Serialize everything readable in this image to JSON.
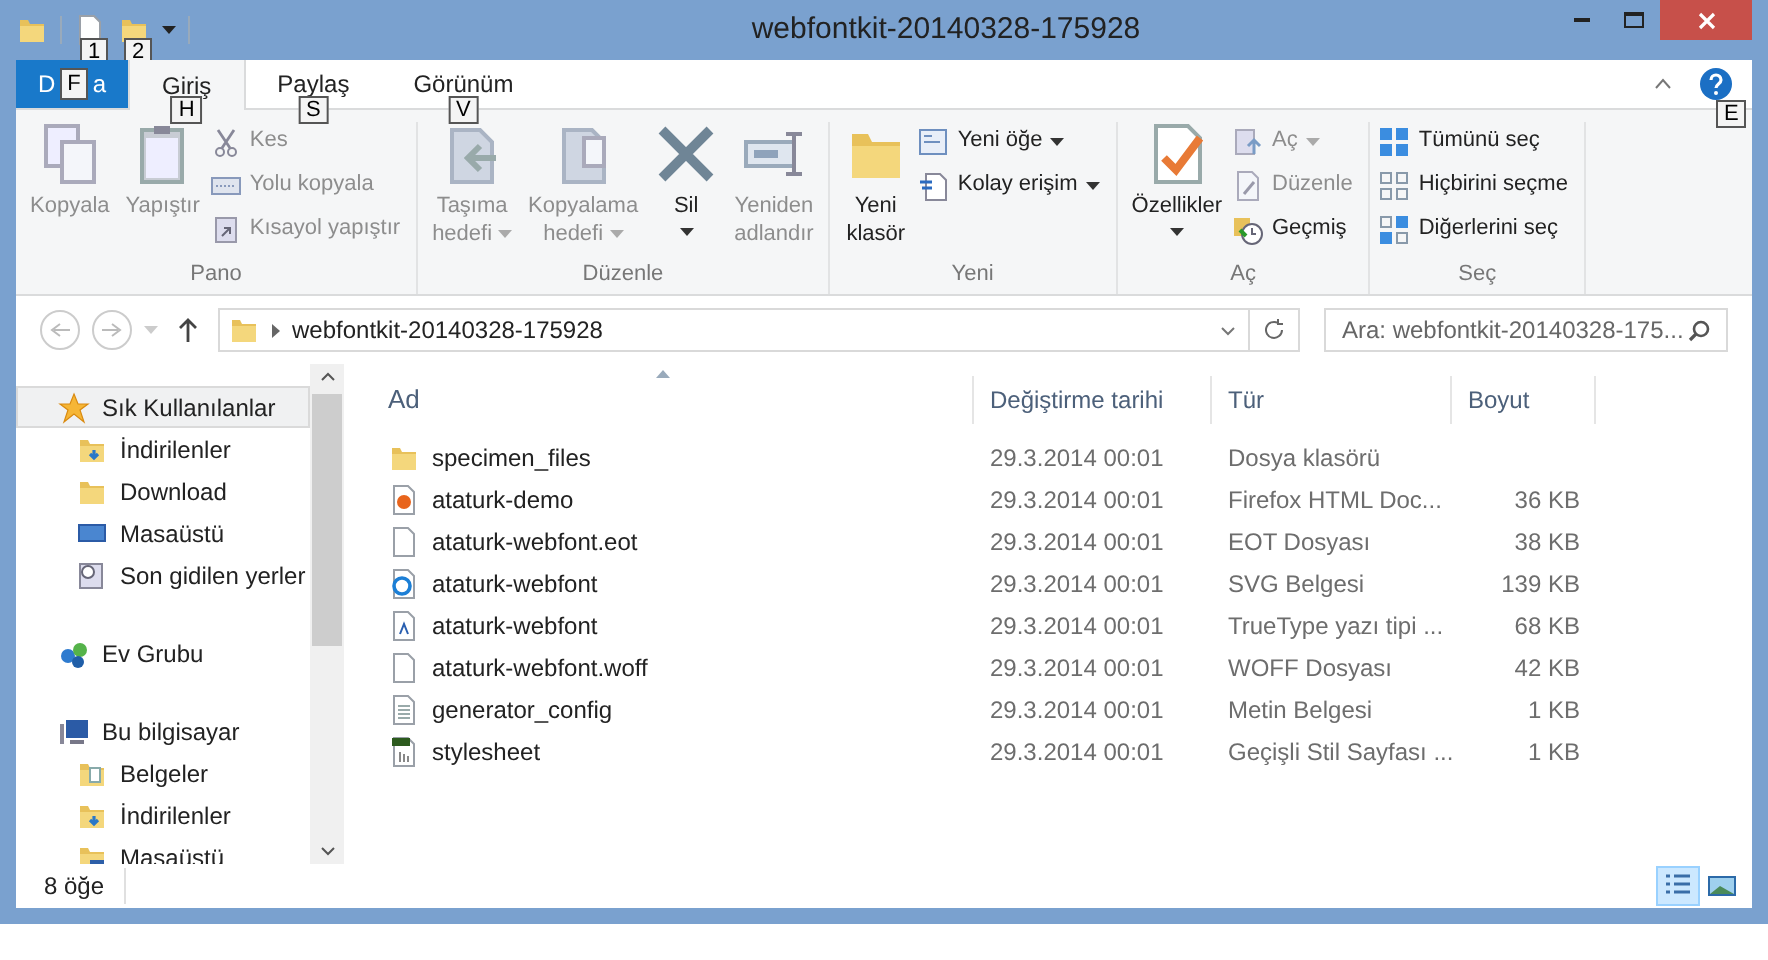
{
  "window": {
    "title": "webfontkit-20140328-175928"
  },
  "quick_access": {
    "keytips": [
      "1",
      "2"
    ]
  },
  "ribbon_tabs": [
    {
      "parts": [
        "D",
        "a"
      ],
      "keytip": "F",
      "kind": "file",
      "selected": false
    },
    {
      "parts": [
        "Giriş"
      ],
      "keytip": "H",
      "kind": "tab",
      "selected": true
    },
    {
      "parts": [
        "Paylaş"
      ],
      "keytip": "S",
      "kind": "tab",
      "selected": false
    },
    {
      "parts": [
        "Görünüm"
      ],
      "keytip": "V",
      "kind": "tab",
      "selected": false
    }
  ],
  "help": {
    "keytip": "E"
  },
  "ribbon_groups": [
    {
      "name": "Pano",
      "items": [
        {
          "kind": "large",
          "lines": [
            "Kopyala"
          ],
          "disabled": true,
          "dropdown": false
        },
        {
          "kind": "large",
          "lines": [
            "Yapıştır"
          ],
          "disabled": true,
          "dropdown": false
        },
        {
          "kind": "stack",
          "children": [
            {
              "label": "Kes",
              "disabled": true,
              "dropdown": false
            },
            {
              "label": "Yolu kopyala",
              "disabled": true,
              "dropdown": false
            },
            {
              "label": "Kısayol yapıştır",
              "disabled": true,
              "dropdown": false
            }
          ]
        }
      ]
    },
    {
      "name": "Düzenle",
      "items": [
        {
          "kind": "large",
          "lines": [
            "Taşıma",
            "hedefi"
          ],
          "disabled": true,
          "dropdown": true
        },
        {
          "kind": "large",
          "lines": [
            "Kopyalama",
            "hedefi"
          ],
          "disabled": true,
          "dropdown": true
        },
        {
          "kind": "large",
          "lines": [
            "Sil"
          ],
          "disabled": false,
          "dropdown": true
        },
        {
          "kind": "large",
          "lines": [
            "Yeniden",
            "adlandır"
          ],
          "disabled": true,
          "dropdown": false
        }
      ]
    },
    {
      "name": "Yeni",
      "items": [
        {
          "kind": "large",
          "lines": [
            "Yeni",
            "klasör"
          ],
          "disabled": false,
          "dropdown": false
        },
        {
          "kind": "stack",
          "children": [
            {
              "label": "Yeni öğe",
              "disabled": false,
              "dropdown": true
            },
            {
              "label": "Kolay erişim",
              "disabled": false,
              "dropdown": true
            }
          ]
        }
      ]
    },
    {
      "name": "Aç",
      "items": [
        {
          "kind": "large",
          "lines": [
            "Özellikler"
          ],
          "disabled": false,
          "dropdown": true
        },
        {
          "kind": "stack",
          "children": [
            {
              "label": "Aç",
              "disabled": true,
              "dropdown": true
            },
            {
              "label": "Düzenle",
              "disabled": true,
              "dropdown": false
            },
            {
              "label": "Geçmiş",
              "disabled": false,
              "dropdown": false
            }
          ]
        }
      ]
    },
    {
      "name": "Seç",
      "items": [
        {
          "kind": "stack",
          "children": [
            {
              "label": "Tümünü seç",
              "disabled": false,
              "dropdown": false
            },
            {
              "label": "Hiçbirini seçme",
              "disabled": false,
              "dropdown": false
            },
            {
              "label": "Diğerlerini seç",
              "disabled": false,
              "dropdown": false
            }
          ]
        }
      ]
    }
  ],
  "address_bar": {
    "path": "webfontkit-20140328-175928"
  },
  "search": {
    "placeholder": "Ara: webfontkit-20140328-175..."
  },
  "sidebar": {
    "sections": [
      {
        "label": "Sık Kullanılanlar",
        "kind": "star",
        "selected": true,
        "children": [
          {
            "label": "İndirilenler",
            "kind": "downloads",
            "selected": false
          },
          {
            "label": "Download",
            "kind": "folder",
            "selected": false
          },
          {
            "label": "Masaüstü",
            "kind": "desktop",
            "selected": false
          },
          {
            "label": "Son gidilen yerler",
            "kind": "recent",
            "selected": false
          }
        ]
      },
      {
        "label": "Ev Grubu",
        "kind": "homegroup",
        "selected": false
      },
      {
        "label": "Bu bilgisayar",
        "kind": "computer",
        "selected": false,
        "children": [
          {
            "label": "Belgeler",
            "kind": "documents",
            "selected": false
          },
          {
            "label": "İndirilenler",
            "kind": "downloads",
            "selected": false
          },
          {
            "label": "Masaüstü",
            "kind": "desktopfolder",
            "selected": false
          }
        ]
      }
    ]
  },
  "table": {
    "columns": [
      "Ad",
      "Değiştirme tarihi",
      "Tür",
      "Boyut"
    ],
    "rows": [
      {
        "name": "specimen_files",
        "kind": "folder",
        "date": "29.3.2014 00:01",
        "type": "Dosya klasörü"
      },
      {
        "name": "ataturk-demo",
        "kind": "firefox",
        "date": "29.3.2014 00:01",
        "type": "Firefox HTML Doc...",
        "size": "36 KB"
      },
      {
        "name": "ataturk-webfont.eot",
        "kind": "blank",
        "date": "29.3.2014 00:01",
        "type": "EOT Dosyası",
        "size": "38 KB"
      },
      {
        "name": "ataturk-webfont",
        "kind": "ie",
        "date": "29.3.2014 00:01",
        "type": "SVG Belgesi",
        "size": "139 KB"
      },
      {
        "name": "ataturk-webfont",
        "kind": "font",
        "date": "29.3.2014 00:01",
        "type": "TrueType yazı tipi ...",
        "size": "68 KB"
      },
      {
        "name": "ataturk-webfont.woff",
        "kind": "blank",
        "date": "29.3.2014 00:01",
        "type": "WOFF Dosyası",
        "size": "42 KB"
      },
      {
        "name": "generator_config",
        "kind": "text",
        "date": "29.3.2014 00:01",
        "type": "Metin Belgesi",
        "size": "1 KB"
      },
      {
        "name": "stylesheet",
        "kind": "css",
        "date": "29.3.2014 00:01",
        "type": "Geçişli Stil Sayfası ...",
        "size": "1 KB"
      }
    ]
  },
  "status_bar": {
    "count": "8 öğe",
    "views": [
      {
        "kind": "details",
        "selected": true
      },
      {
        "kind": "thumbnails",
        "selected": false
      }
    ]
  }
}
